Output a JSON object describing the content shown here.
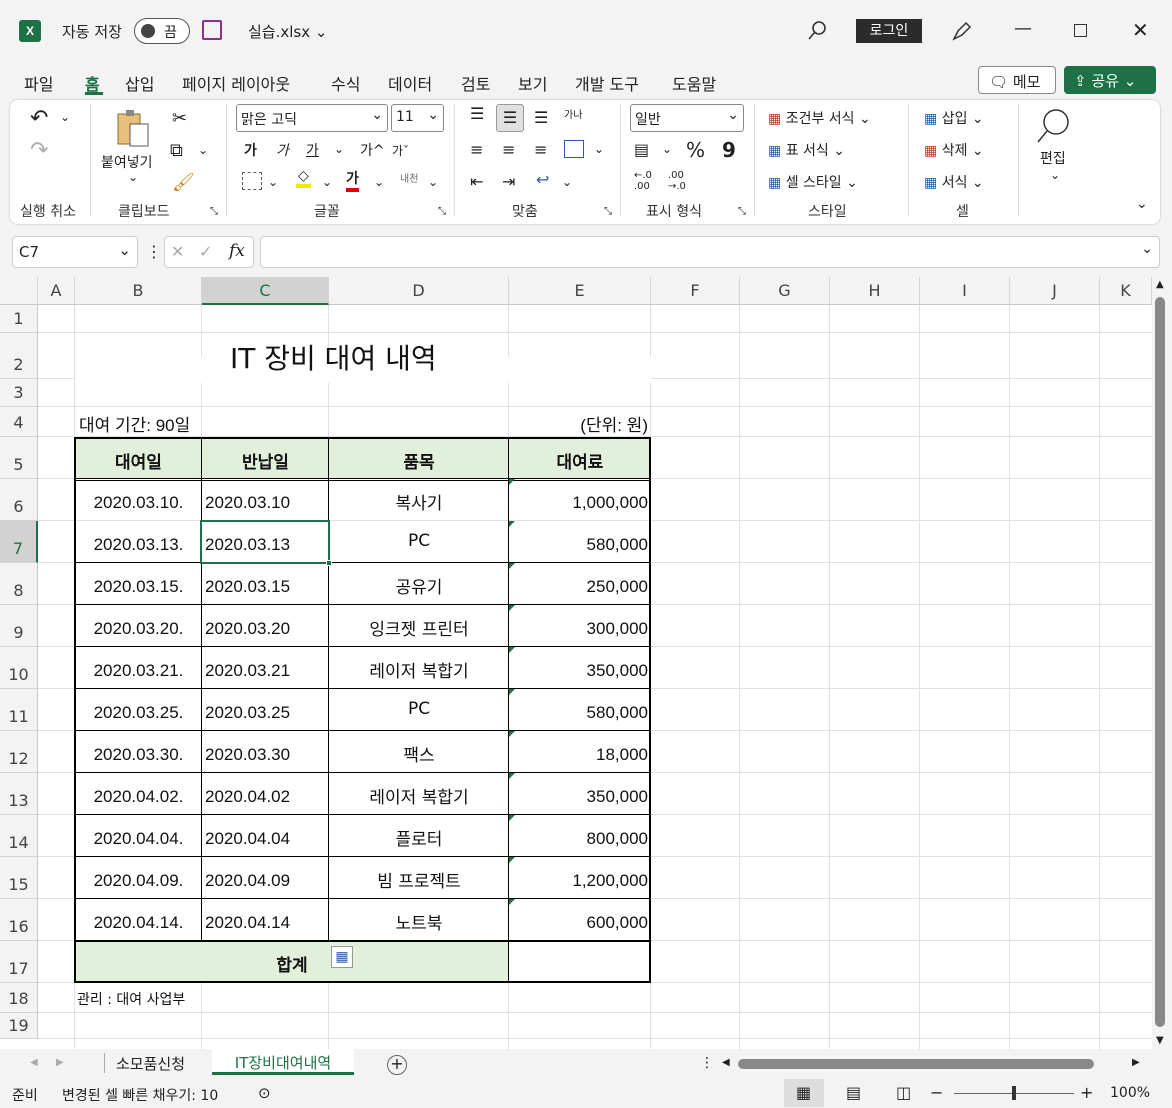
{
  "titlebar": {
    "app_icon_letter": "X",
    "autosave_label": "자동 저장",
    "autosave_toggle": "끔",
    "filename": "실습.xlsx",
    "login": "로그인"
  },
  "menu": {
    "tabs": [
      "파일",
      "홈",
      "삽입",
      "페이지 레이아웃",
      "수식",
      "데이터",
      "검토",
      "보기",
      "개발 도구",
      "도움말"
    ],
    "memo": "메모",
    "share": "공유"
  },
  "ribbon": {
    "undo_group": "실행 취소",
    "clipboard": {
      "paste": "붙여넣기",
      "group": "클립보드"
    },
    "font": {
      "name": "맑은 고딕",
      "size": "11",
      "bold": "가",
      "italic": "가",
      "underline": "가",
      "grow": "가",
      "shrink": "가",
      "color": "가",
      "phonetic": "내천",
      "group": "글꼴"
    },
    "align": {
      "wrap": "가나",
      "group": "맞춤"
    },
    "number": {
      "format": "일반",
      "percent": "%",
      "comma": "9",
      "group": "표시 형식",
      "inc_decimal": "←.0 .00",
      "dec_decimal": ".00 →.0"
    },
    "styles": {
      "conditional": "조건부 서식",
      "table": "표 서식",
      "cell_style": "셀 스타일",
      "group": "스타일"
    },
    "cells": {
      "insert": "삽입",
      "delete": "삭제",
      "format": "서식",
      "group": "셀"
    },
    "editing": {
      "label": "편집"
    }
  },
  "formula_bar": {
    "name_box": "C7",
    "value": ""
  },
  "columns": [
    "A",
    "B",
    "C",
    "D",
    "E",
    "F",
    "G",
    "H",
    "I",
    "J",
    "K"
  ],
  "rows": [
    "1",
    "2",
    "3",
    "4",
    "5",
    "6",
    "7",
    "8",
    "9",
    "10",
    "11",
    "12",
    "13",
    "14",
    "15",
    "16",
    "17",
    "18",
    "19"
  ],
  "sheet": {
    "title": "IT 장비 대여 내역",
    "period": "대여 기간: 90일",
    "unit": "(단위: 원)",
    "headers": [
      "대여일",
      "반납일",
      "품목",
      "대여료"
    ],
    "data": [
      [
        "2020.03.10.",
        "2020.03.10",
        "복사기",
        "1,000,000"
      ],
      [
        "2020.03.13.",
        "2020.03.13",
        "PC",
        "580,000"
      ],
      [
        "2020.03.15.",
        "2020.03.15",
        "공유기",
        "250,000"
      ],
      [
        "2020.03.20.",
        "2020.03.20",
        "잉크젯 프린터",
        "300,000"
      ],
      [
        "2020.03.21.",
        "2020.03.21",
        "레이저 복합기",
        "350,000"
      ],
      [
        "2020.03.25.",
        "2020.03.25",
        "PC",
        "580,000"
      ],
      [
        "2020.03.30.",
        "2020.03.30",
        "팩스",
        "18,000"
      ],
      [
        "2020.04.02.",
        "2020.04.02",
        "레이저 복합기",
        "350,000"
      ],
      [
        "2020.04.04.",
        "2020.04.04",
        "플로터",
        "800,000"
      ],
      [
        "2020.04.09.",
        "2020.04.09",
        "빔 프로젝트",
        "1,200,000"
      ],
      [
        "2020.04.14.",
        "2020.04.14",
        "노트북",
        "600,000"
      ]
    ],
    "total_label": "합계",
    "footer": "관리 : 대여 사업부"
  },
  "tabs": [
    "소모품신청",
    "IT장비대여내역"
  ],
  "status": {
    "ready": "준비",
    "flash_fill": "변경된 셀 빠른 채우기: 10",
    "zoom": "100%"
  },
  "colors": {
    "header_fill": "#e2efda",
    "excel_green": "#1e7145",
    "selection": "#217346"
  }
}
